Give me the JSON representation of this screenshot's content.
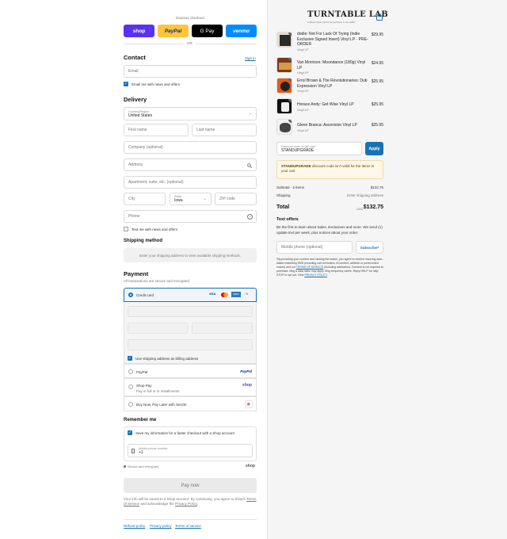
{
  "express": {
    "label": "Express checkout",
    "or": "OR",
    "buttons": [
      "shop",
      "PayPal",
      "G Pay",
      "venmo"
    ]
  },
  "contact": {
    "heading": "Contact",
    "signin": "Sign in",
    "email_placeholder": "Email",
    "news_label": "Email me with news and offers"
  },
  "delivery": {
    "heading": "Delivery",
    "country_label": "Country/Region",
    "country_value": "United States",
    "first_name": "First name",
    "last_name": "Last name",
    "company": "Company (optional)",
    "address": "Address",
    "apartment": "Apartment, suite, etc. (optional)",
    "city": "City",
    "state_label": "State",
    "state_value": "Iowa",
    "zip": "ZIP code",
    "phone": "Phone",
    "text_label": "Text me with news and offers"
  },
  "shipping": {
    "heading": "Shipping method",
    "message": "Enter your shipping address to view available shipping methods."
  },
  "payment": {
    "heading": "Payment",
    "subtitle": "All transactions are secure and encrypted.",
    "credit_card": "Credit card",
    "card_brands": [
      "VISA",
      "MC",
      "AMEX",
      "+5"
    ],
    "billing_label": "Use shipping address as billing address",
    "paypal": "PayPal",
    "paypal_logo": "PayPal",
    "shoppay": "Shop Pay",
    "shoppay_sub": "Pay in full or in installments",
    "shoppay_logo": "shop",
    "sezzle": "Buy Now, Pay Later with Sezzle"
  },
  "remember": {
    "heading": "Remember me",
    "save_label": "Save my information for a faster checkout with a Shop account",
    "mobile_label": "Mobile phone number",
    "mobile_value": "+1",
    "secure": "Secure and encrypted",
    "shop_logo": "shop"
  },
  "pay_now": "Pay now",
  "terms": {
    "text": "Your info will be saved to a Shop account. By continuing, you agree to Shop's",
    "tos": "Terms of Service",
    "and": "and acknowledge the",
    "privacy": "Privacy Policy",
    "end": "."
  },
  "footer": [
    "Refund policy",
    "Privacy policy",
    "Terms of service"
  ],
  "brand": {
    "name": "TURNTABLE LAB",
    "tag": "A Better Music Store Somewhere in the 2000"
  },
  "products": [
    {
      "qty": "1",
      "title": "dodie: Not For Lack Of Trying (Indie Exclusive Signed Insert) Vinyl LP - PRE-ORDER",
      "sub": "Vinyl LP",
      "price": "$29.95"
    },
    {
      "qty": "1",
      "title": "Van Morrison: Moondance (180g) Vinyl LP",
      "sub": "Vinyl LP",
      "price": "$24.95"
    },
    {
      "qty": "1",
      "title": "Errol Brown & The Revolutionaries: Dub Expression Vinyl LP",
      "sub": "Vinyl LP",
      "price": "$25.95"
    },
    {
      "qty": "1",
      "title": "Horace Andy: Get Wise Vinyl LP",
      "sub": "Vinyl LP",
      "price": "$25.95"
    },
    {
      "qty": "1",
      "title": "Glenn Branca: Ascension Vinyl LP",
      "sub": "Vinyl LP",
      "price": "$25.95"
    }
  ],
  "discount": {
    "label": "Discount code or gift card",
    "value": "STANDUPGRADE",
    "apply": "Apply",
    "error_code": "STANDUPGRADE",
    "error_text": "discount code isn't valid for the items in your cart"
  },
  "summary": {
    "subtotal_label": "Subtotal · 5 items",
    "subtotal": "$132.75",
    "shipping_label": "Shipping",
    "shipping_value": "Enter shipping address",
    "total_label": "Total",
    "currency": "USD",
    "total": "$132.75"
  },
  "text_offers": {
    "heading": "Text offers",
    "desc": "Be the first to learn about Sales, Exclusives and more. We send (1) update text per week, plus notices about your order.",
    "phone_placeholder": "Mobile phone (optional)",
    "subscribe": "Subscribe*",
    "legal": "*By providing your number and clicking the button, you agree to receive recurring auto-dialed marketing SMS (including cart reminders, AI content, artificial or prerecorded voices) and our",
    "legal_terms": "TERMS OF SERVICE",
    "legal_2": "(including arbitration). Consent is not required to purchase. Msg & data rates may apply. Msg frequency varies. Reply HELP for help; STOP to opt out. View",
    "legal_privacy": "PRIVACY POLICY",
    "legal_end": "."
  },
  "colors": {
    "accent": "#1773b0",
    "shop": "#5a31f4",
    "paypal": "#ffc439",
    "venmo": "#008cff",
    "error_bg": "#fff8e8"
  }
}
